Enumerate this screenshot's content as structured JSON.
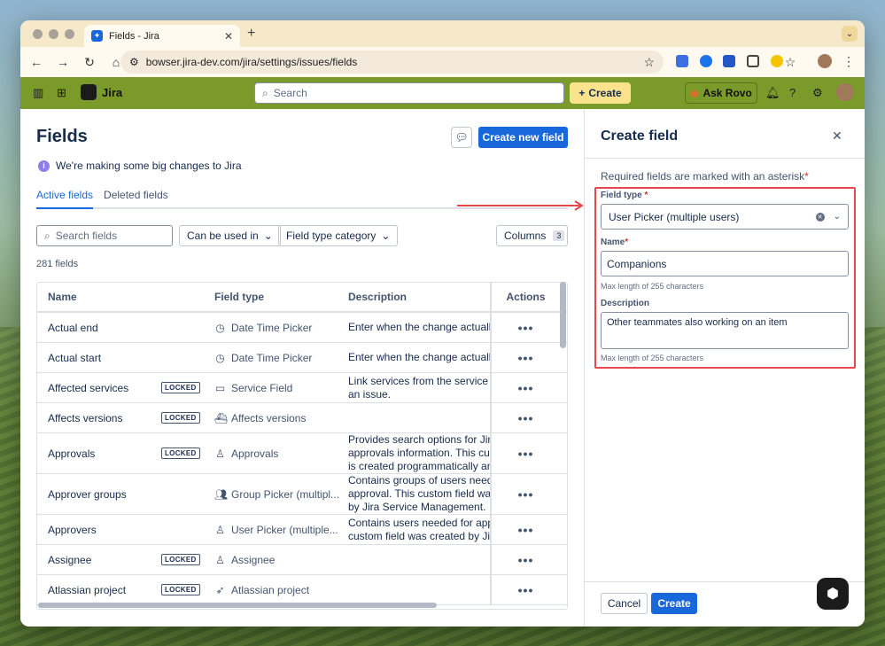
{
  "browser": {
    "tab_title": "Fields - Jira",
    "url": "bowser.jira-dev.com/jira/settings/issues/fields"
  },
  "jira_header": {
    "app_name": "Jira",
    "search_placeholder": "Search",
    "create_label": "Create",
    "ask_rovo_label": "Ask Rovo"
  },
  "page": {
    "title": "Fields",
    "primary_button": "Create new field",
    "notice": "We're making some big changes to Jira",
    "tabs": [
      "Active fields",
      "Deleted fields"
    ],
    "search_placeholder": "Search fields",
    "filter_used_in": "Can be used in",
    "filter_category": "Field type category",
    "columns_label": "Columns",
    "columns_count": "3",
    "field_count": "281 fields"
  },
  "table": {
    "headers": {
      "name": "Name",
      "type": "Field type",
      "description": "Description",
      "actions": "Actions"
    },
    "rows": [
      {
        "name": "Actual end",
        "locked": "",
        "type": "Date Time Picker",
        "icon": "clock-icon",
        "desc1": "Enter when the change actually",
        "desc2": "",
        "desc3": ""
      },
      {
        "name": "Actual start",
        "locked": "",
        "type": "Date Time Picker",
        "icon": "clock-icon",
        "desc1": "Enter when the change actually",
        "desc2": "",
        "desc3": ""
      },
      {
        "name": "Affected services",
        "locked": "LOCKED",
        "type": "Service Field",
        "icon": "service-icon",
        "desc1": "Link services from the service re",
        "desc2": "an issue.",
        "desc3": ""
      },
      {
        "name": "Affects versions",
        "locked": "LOCKED",
        "type": "Affects versions",
        "icon": "ship-icon",
        "desc1": "",
        "desc2": "",
        "desc3": ""
      },
      {
        "name": "Approvals",
        "locked": "LOCKED",
        "type": "Approvals",
        "icon": "approval-icon",
        "desc1": "Provides search options for Jira",
        "desc2": "approvals information. This cust",
        "desc3": "is created programmatically and"
      },
      {
        "name": "Approver groups",
        "locked": "",
        "type": "Group Picker (multipl...",
        "icon": "group-icon",
        "desc1": "Contains groups of users neede",
        "desc2": "approval. This custom field was",
        "desc3": "by Jira Service Management."
      },
      {
        "name": "Approvers",
        "locked": "",
        "type": "User Picker (multiple...",
        "icon": "user-icon",
        "desc1": "Contains users needed for appro",
        "desc2": "custom field was created by Jira",
        "desc3": ""
      },
      {
        "name": "Assignee",
        "locked": "LOCKED",
        "type": "Assignee",
        "icon": "user-icon",
        "desc1": "",
        "desc2": "",
        "desc3": ""
      },
      {
        "name": "Atlassian project",
        "locked": "LOCKED",
        "type": "Atlassian project",
        "icon": "rocket-icon",
        "desc1": "",
        "desc2": "",
        "desc3": ""
      }
    ]
  },
  "panel": {
    "title": "Create field",
    "required_note": "Required fields are marked with an asterisk",
    "asterisk": "*",
    "field_type_label": "Field type",
    "field_type_value": "User Picker (multiple users)",
    "name_label": "Name",
    "name_value": "Companions",
    "name_hint": "Max length of 255 characters",
    "description_label": "Description",
    "description_value": "Other teammates also working on an item",
    "description_hint": "Max length of 255 characters",
    "cancel_label": "Cancel",
    "create_label": "Create"
  },
  "colors": {
    "jira_header": "#7a9a2a",
    "primary": "#1868db",
    "annotation_red": "#e5484d"
  }
}
